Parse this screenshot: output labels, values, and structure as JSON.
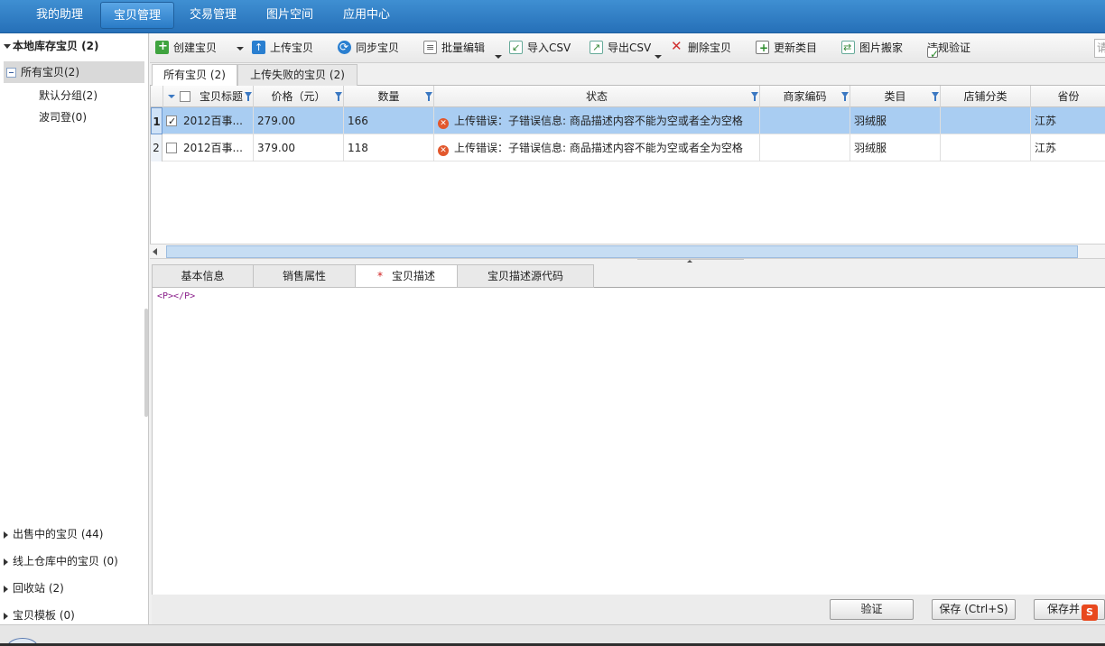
{
  "topnav": {
    "tabs": [
      {
        "label": "我的助理"
      },
      {
        "label": "宝贝管理"
      },
      {
        "label": "交易管理"
      },
      {
        "label": "图片空间"
      },
      {
        "label": "应用中心"
      }
    ],
    "active": 1
  },
  "sidebar": {
    "header": "本地库存宝贝 (2)",
    "all_items": "所有宝贝(2)",
    "groups": [
      {
        "label": "默认分组(2)"
      },
      {
        "label": "波司登(0)"
      }
    ],
    "sections": [
      {
        "label": "出售中的宝贝 (44)"
      },
      {
        "label": "线上仓库中的宝贝 (0)"
      },
      {
        "label": "回收站 (2)"
      },
      {
        "label": "宝贝模板 (0)"
      }
    ]
  },
  "toolbar": {
    "create": "创建宝贝",
    "upload": "上传宝贝",
    "sync": "同步宝贝",
    "batch_edit": "批量编辑",
    "import_csv": "导入CSV",
    "export_csv": "导出CSV",
    "delete": "删除宝贝",
    "update_category": "更新类目",
    "image_move": "图片搬家",
    "violation_check": "违规验证",
    "search_placeholder": "请"
  },
  "subtabs": [
    {
      "label": "所有宝贝 (2)"
    },
    {
      "label": "上传失败的宝贝 (2)"
    }
  ],
  "grid": {
    "columns": [
      "宝贝标题",
      "价格（元）",
      "数量",
      "状态",
      "商家编码",
      "类目",
      "店铺分类",
      "省份"
    ],
    "rows": [
      {
        "num": "1",
        "checked": true,
        "title": "2012百事...",
        "price": "279.00",
        "qty": "166",
        "status": "上传错误：子错误信息: 商品描述内容不能为空或者全为空格",
        "code": "",
        "category": "羽绒服",
        "shop_cat": "",
        "province": "江苏"
      },
      {
        "num": "2",
        "checked": false,
        "title": "2012百事...",
        "price": "379.00",
        "qty": "118",
        "status": "上传错误：子错误信息: 商品描述内容不能为空或者全为空格",
        "code": "",
        "category": "羽绒服",
        "shop_cat": "",
        "province": "江苏"
      }
    ]
  },
  "detail_tabs": [
    {
      "label": "基本信息"
    },
    {
      "label": "销售属性"
    },
    {
      "label": "宝贝描述",
      "star": "*"
    },
    {
      "label": "宝贝描述源代码"
    }
  ],
  "editor": {
    "content": "<P></P>"
  },
  "buttons": {
    "verify": "验证",
    "save": "保存 (Ctrl+S)",
    "save_and": "保存并"
  },
  "ime_badge": "S"
}
